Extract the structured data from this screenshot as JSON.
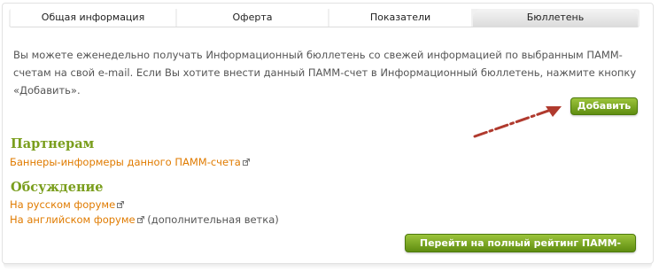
{
  "tabs": [
    {
      "label": "Общая информация"
    },
    {
      "label": "Оферта"
    },
    {
      "label": "Показатели"
    },
    {
      "label": "Бюллетень"
    }
  ],
  "intro_text": "Вы можете еженедельно получать Информационный бюллетень со свежей информацией по выбранным ПАММ-счетам на свой e-mail. Если Вы хотите внести данный ПАММ-счет в Информационный бюллетень, нажмите кнопку «Добавить».",
  "add_button": "Добавить",
  "partners": {
    "heading": "Партнерам",
    "link": "Баннеры-информеры данного ПАММ-счета"
  },
  "discussion": {
    "heading": "Обсуждение",
    "russian_forum": "На русском форуме",
    "english_forum": "На английском форуме",
    "english_note": "(дополнительная ветка)"
  },
  "rating_button": "Перейти на полный рейтинг ПАММ-счетов",
  "colors": {
    "accent_green": "#7a9e1d",
    "link_orange": "#e07b00",
    "arrow_red": "#b03a2e"
  }
}
